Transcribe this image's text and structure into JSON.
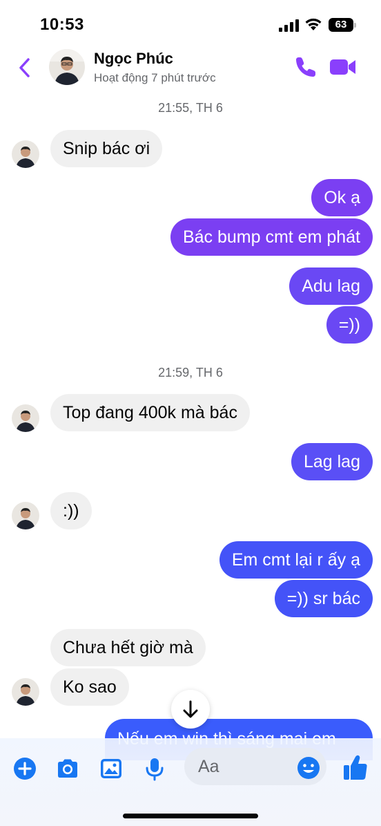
{
  "status_bar": {
    "time": "10:53",
    "battery": "63"
  },
  "header": {
    "contact_name": "Ngọc Phúc",
    "activity_status": "Hoạt động 7 phút trước"
  },
  "conversation": {
    "timestamps": [
      "21:55, TH 6",
      "21:59, TH 6"
    ],
    "messages": [
      "Snip bác ơi",
      "Ok ạ",
      "Bác bump cmt em phát",
      "Adu lag",
      "=))",
      "Top đang 400k mà bác",
      "Lag lag",
      ":))",
      "Em cmt lại r ấy ạ",
      "=)) sr bác",
      "Chưa hết giờ mà",
      "Ko sao",
      "Nếu em win thì sáng mai em"
    ]
  },
  "composer": {
    "placeholder": "Aa"
  },
  "colors": {
    "accent": "#8a3ffc",
    "incoming_bubble": "#f0f0f0",
    "outgoing_top": "#7b3ff2",
    "outgoing_bottom": "#3b5bfb"
  },
  "icons": [
    "back-chevron-icon",
    "phone-icon",
    "video-camera-icon",
    "plus-icon",
    "camera-icon",
    "image-icon",
    "microphone-icon",
    "emoji-icon",
    "thumbs-up-icon",
    "arrow-down-icon"
  ]
}
